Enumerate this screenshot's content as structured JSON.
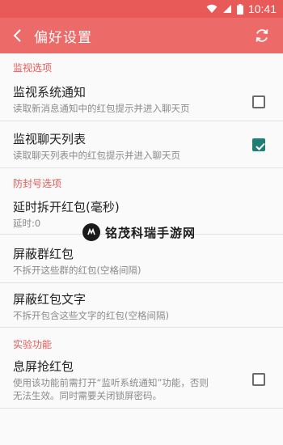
{
  "status_bar": {
    "time": "10:41",
    "icons": [
      "wifi-icon",
      "signal-icon",
      "battery-icon"
    ]
  },
  "app_bar": {
    "title": "偏好设置",
    "back_icon": "back-arrow-icon",
    "refresh_icon": "refresh-icon"
  },
  "colors": {
    "accent": "#ec6a67",
    "status": "#e85a57",
    "checkbox_checked": "#1f7f74"
  },
  "sections": {
    "monitor": {
      "header": "监视选项",
      "items": [
        {
          "title": "监视系统通知",
          "subtitle": "读取新消息通知中的红包提示并进入聊天页",
          "checked": false
        },
        {
          "title": "监视聊天列表",
          "subtitle": "读取聊天列表中的红包提示并进入聊天页",
          "checked": true
        }
      ]
    },
    "anti_ban": {
      "header": "防封号选项",
      "items": [
        {
          "title": "延时拆开红包(毫秒)",
          "subtitle": "延时:0"
        },
        {
          "title": "屏蔽群红包",
          "subtitle": "不拆开这些群的红包(空格间隔)"
        },
        {
          "title": "屏蔽红包文字",
          "subtitle": "不拆开包含这些文字的红包(空格间隔)"
        }
      ]
    },
    "experimental": {
      "header": "实验功能",
      "items": [
        {
          "title": "息屏抢红包",
          "subtitle_line1": "使用该功能前需打开“监听系统通知”功能，否则",
          "subtitle_line2": "无法生效。同时需要关闭锁屏密码。",
          "checked": false
        }
      ]
    }
  },
  "watermark": {
    "text": "铭茂科瑞手游网"
  }
}
